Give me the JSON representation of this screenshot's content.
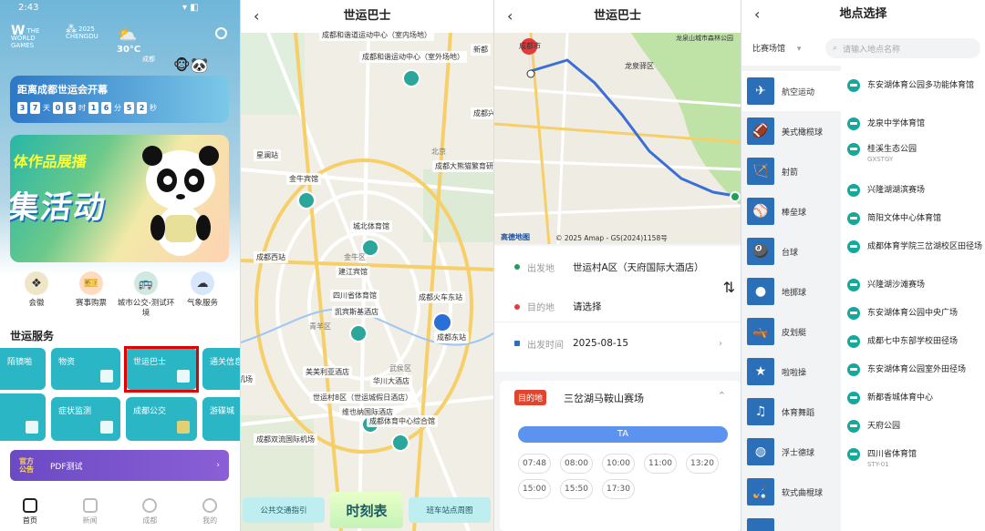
{
  "p1": {
    "time": "2:43",
    "status_icons": "▾ ◧",
    "logo1": "THE WORLD GAMES",
    "logo2": "2025 CHENGDU",
    "weather_temp": "30°C",
    "weather_city": "成都",
    "countdown_title": "距离成都世运会开幕",
    "countdown": [
      {
        "v": "3"
      },
      {
        "v": "7"
      },
      {
        "u": "天"
      },
      {
        "v": "0"
      },
      {
        "v": "5"
      },
      {
        "u": "时"
      },
      {
        "v": "1"
      },
      {
        "v": "6"
      },
      {
        "u": "分"
      },
      {
        "v": "5"
      },
      {
        "v": "2"
      },
      {
        "u": "秒"
      }
    ],
    "banner_line1": "体作品展播",
    "banner_line2": "集活动",
    "quick": [
      "会徽",
      "赛事购票",
      "城市公交-测试环境",
      "气象服务"
    ],
    "section_title": "世运服务",
    "tiles": [
      "陌镜啪啪审",
      "物资",
      "世运巴士",
      "通关信息",
      "症状监测",
      "成都公交",
      "游碟城"
    ],
    "pdf_tag": "官方公告",
    "pdf_text": "PDF测试",
    "nav": [
      "首页",
      "新闻",
      "成都",
      "我的"
    ]
  },
  "p2": {
    "title": "世运巴士",
    "labels": [
      "成都和谐道运动中心（室内场地）",
      "成都和谐运动中心（室外场地）",
      "新都",
      "成都兴",
      "金牛宾馆",
      "城北体育馆",
      "星澜站",
      "成都西站",
      "建江宾馆",
      "四川省体育馆",
      "凯宾斯基酒店",
      "成都火车东站",
      "成都大熊猫繁育研究基地",
      "成都东站",
      "机场",
      "美美利亚酒店",
      "华川大酒店",
      "世运村8区（世运城假日酒店）",
      "维也纳国际酒店",
      "成都体育中心综合馆",
      "成都双流国际机场",
      "北京",
      "金牛区",
      "青羊区",
      "武侯区"
    ],
    "buttons": [
      "公共交通指引",
      "时刻表",
      "班车站点周图"
    ]
  },
  "p3": {
    "title": "世运巴士",
    "map_labels": [
      "成都市",
      "龙泉驿区",
      "龙泉山城市森林公园",
      "高德地图",
      "© 2025 Amap - GS(2024)1158号"
    ],
    "from_label": "出发地",
    "from_value": "世运村A区（天府国际大酒店）",
    "to_label": "目的地",
    "to_value": "请选择",
    "date_label": "出发时间",
    "date_value": "2025-08-15",
    "dest_tag": "目的地",
    "dest_name": "三岔湖马鞍山赛场",
    "route": "TA",
    "times": [
      "07:48",
      "08:00",
      "10:00",
      "11:00",
      "13:20",
      "15:00",
      "15:50",
      "17:30"
    ]
  },
  "p4": {
    "title": "地点选择",
    "filter": "比赛场馆",
    "search_placeholder": "请输入地点名称",
    "categories": [
      "航空运动",
      "美式橄榄球",
      "射箭",
      "棒垒球",
      "台球",
      "地掷球",
      "皮划艇",
      "啦啦操",
      "体育舞蹈",
      "浮士德球",
      "软式曲棍球",
      ""
    ],
    "venues": [
      {
        "name": "东安湖体育公园多功能体育馆",
        "sub": ""
      },
      {
        "name": "龙泉中学体育馆",
        "sub": ""
      },
      {
        "name": "桂溪生态公园",
        "sub": "GXSTGY"
      },
      {
        "name": "兴隆湖湖滨赛场",
        "sub": ""
      },
      {
        "name": "简阳文体中心体育馆",
        "sub": ""
      },
      {
        "name": "成都体育学院三岔湖校区田径场",
        "sub": ""
      },
      {
        "name": "兴隆湖沙滩赛场",
        "sub": ""
      },
      {
        "name": "东安湖体育公园中央广场",
        "sub": ""
      },
      {
        "name": "成都七中东部学校田径场",
        "sub": ""
      },
      {
        "name": "东安湖体育公园室外田径场",
        "sub": ""
      },
      {
        "name": "新都香城体育中心",
        "sub": ""
      },
      {
        "name": "天府公园",
        "sub": ""
      },
      {
        "name": "四川省体育馆",
        "sub": "STY-01"
      }
    ]
  },
  "colors": {
    "accent": "#2a6fb8",
    "teal": "#16a89a",
    "route": "#3b6fd8",
    "highlight": "#e00000"
  }
}
